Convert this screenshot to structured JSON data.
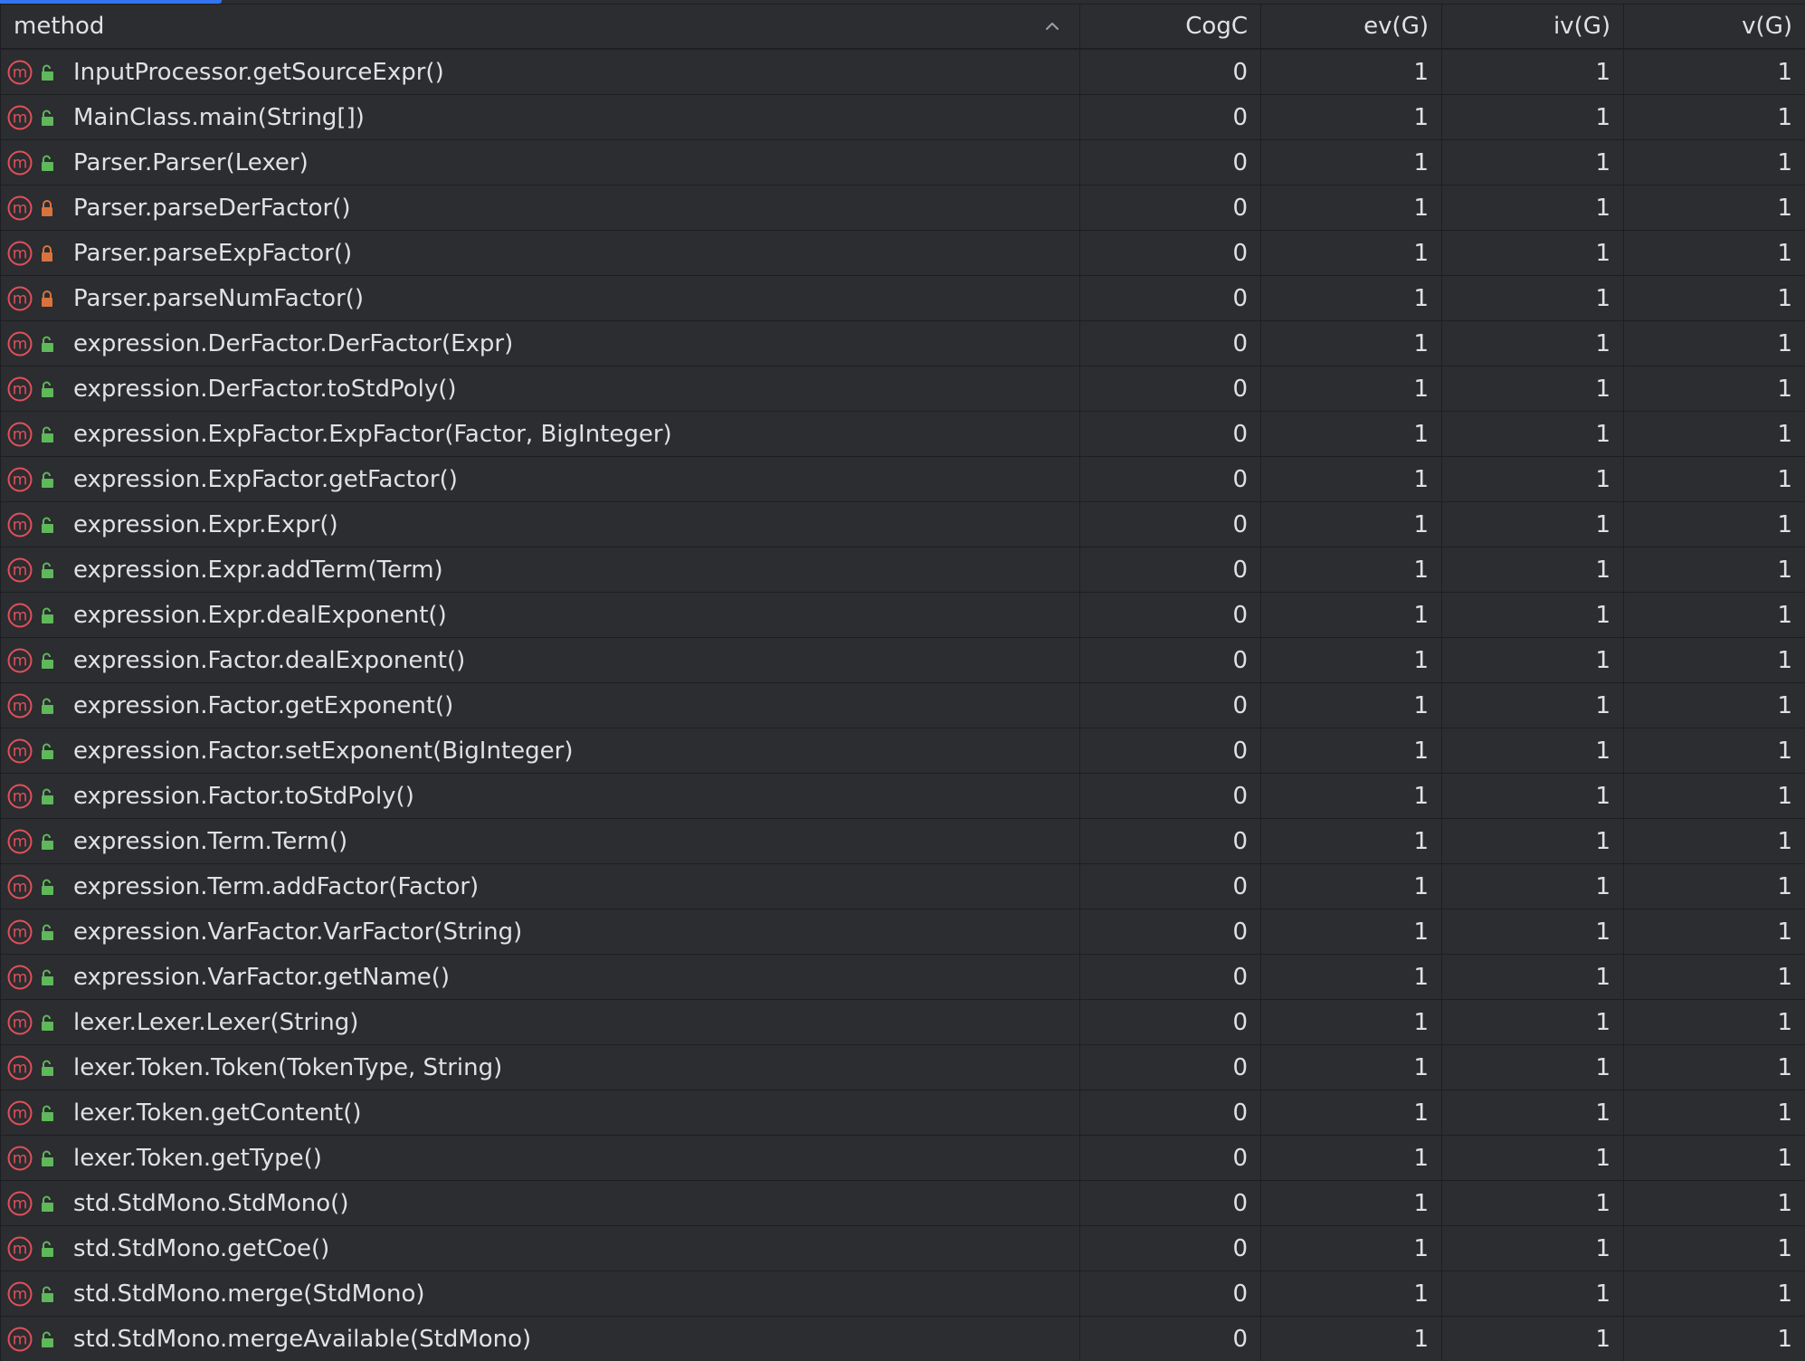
{
  "columns": {
    "method": "method",
    "cogc": "CogC",
    "evg": "ev(G)",
    "ivg": "iv(G)",
    "vg": "v(G)"
  },
  "sort_icon": "sort-ascending-icon",
  "colors": {
    "background": "#2b2d30",
    "grid": "#1e1f22",
    "text": "#dfe1e5",
    "method_icon": "#e0505a",
    "public_icon": "#5fb85a",
    "private_icon": "#d9733d",
    "accent": "#3574f0"
  },
  "rows": [
    {
      "method": "InputProcessor.getSourceExpr()",
      "visibility": "public",
      "cogc": "0",
      "evg": "1",
      "ivg": "1",
      "vg": "1"
    },
    {
      "method": "MainClass.main(String[])",
      "visibility": "public",
      "cogc": "0",
      "evg": "1",
      "ivg": "1",
      "vg": "1"
    },
    {
      "method": "Parser.Parser(Lexer)",
      "visibility": "public",
      "cogc": "0",
      "evg": "1",
      "ivg": "1",
      "vg": "1"
    },
    {
      "method": "Parser.parseDerFactor()",
      "visibility": "private",
      "cogc": "0",
      "evg": "1",
      "ivg": "1",
      "vg": "1"
    },
    {
      "method": "Parser.parseExpFactor()",
      "visibility": "private",
      "cogc": "0",
      "evg": "1",
      "ivg": "1",
      "vg": "1"
    },
    {
      "method": "Parser.parseNumFactor()",
      "visibility": "private",
      "cogc": "0",
      "evg": "1",
      "ivg": "1",
      "vg": "1"
    },
    {
      "method": "expression.DerFactor.DerFactor(Expr)",
      "visibility": "public",
      "cogc": "0",
      "evg": "1",
      "ivg": "1",
      "vg": "1"
    },
    {
      "method": "expression.DerFactor.toStdPoly()",
      "visibility": "public",
      "cogc": "0",
      "evg": "1",
      "ivg": "1",
      "vg": "1"
    },
    {
      "method": "expression.ExpFactor.ExpFactor(Factor, BigInteger)",
      "visibility": "public",
      "cogc": "0",
      "evg": "1",
      "ivg": "1",
      "vg": "1"
    },
    {
      "method": "expression.ExpFactor.getFactor()",
      "visibility": "public",
      "cogc": "0",
      "evg": "1",
      "ivg": "1",
      "vg": "1"
    },
    {
      "method": "expression.Expr.Expr()",
      "visibility": "public",
      "cogc": "0",
      "evg": "1",
      "ivg": "1",
      "vg": "1"
    },
    {
      "method": "expression.Expr.addTerm(Term)",
      "visibility": "public",
      "cogc": "0",
      "evg": "1",
      "ivg": "1",
      "vg": "1"
    },
    {
      "method": "expression.Expr.dealExponent()",
      "visibility": "public",
      "cogc": "0",
      "evg": "1",
      "ivg": "1",
      "vg": "1"
    },
    {
      "method": "expression.Factor.dealExponent()",
      "visibility": "public",
      "cogc": "0",
      "evg": "1",
      "ivg": "1",
      "vg": "1"
    },
    {
      "method": "expression.Factor.getExponent()",
      "visibility": "public",
      "cogc": "0",
      "evg": "1",
      "ivg": "1",
      "vg": "1"
    },
    {
      "method": "expression.Factor.setExponent(BigInteger)",
      "visibility": "public",
      "cogc": "0",
      "evg": "1",
      "ivg": "1",
      "vg": "1"
    },
    {
      "method": "expression.Factor.toStdPoly()",
      "visibility": "public",
      "cogc": "0",
      "evg": "1",
      "ivg": "1",
      "vg": "1"
    },
    {
      "method": "expression.Term.Term()",
      "visibility": "public",
      "cogc": "0",
      "evg": "1",
      "ivg": "1",
      "vg": "1"
    },
    {
      "method": "expression.Term.addFactor(Factor)",
      "visibility": "public",
      "cogc": "0",
      "evg": "1",
      "ivg": "1",
      "vg": "1"
    },
    {
      "method": "expression.VarFactor.VarFactor(String)",
      "visibility": "public",
      "cogc": "0",
      "evg": "1",
      "ivg": "1",
      "vg": "1"
    },
    {
      "method": "expression.VarFactor.getName()",
      "visibility": "public",
      "cogc": "0",
      "evg": "1",
      "ivg": "1",
      "vg": "1"
    },
    {
      "method": "lexer.Lexer.Lexer(String)",
      "visibility": "public",
      "cogc": "0",
      "evg": "1",
      "ivg": "1",
      "vg": "1"
    },
    {
      "method": "lexer.Token.Token(TokenType, String)",
      "visibility": "public",
      "cogc": "0",
      "evg": "1",
      "ivg": "1",
      "vg": "1"
    },
    {
      "method": "lexer.Token.getContent()",
      "visibility": "public",
      "cogc": "0",
      "evg": "1",
      "ivg": "1",
      "vg": "1"
    },
    {
      "method": "lexer.Token.getType()",
      "visibility": "public",
      "cogc": "0",
      "evg": "1",
      "ivg": "1",
      "vg": "1"
    },
    {
      "method": "std.StdMono.StdMono()",
      "visibility": "public",
      "cogc": "0",
      "evg": "1",
      "ivg": "1",
      "vg": "1"
    },
    {
      "method": "std.StdMono.getCoe()",
      "visibility": "public",
      "cogc": "0",
      "evg": "1",
      "ivg": "1",
      "vg": "1"
    },
    {
      "method": "std.StdMono.merge(StdMono)",
      "visibility": "public",
      "cogc": "0",
      "evg": "1",
      "ivg": "1",
      "vg": "1"
    },
    {
      "method": "std.StdMono.mergeAvailable(StdMono)",
      "visibility": "public",
      "cogc": "0",
      "evg": "1",
      "ivg": "1",
      "vg": "1"
    }
  ]
}
